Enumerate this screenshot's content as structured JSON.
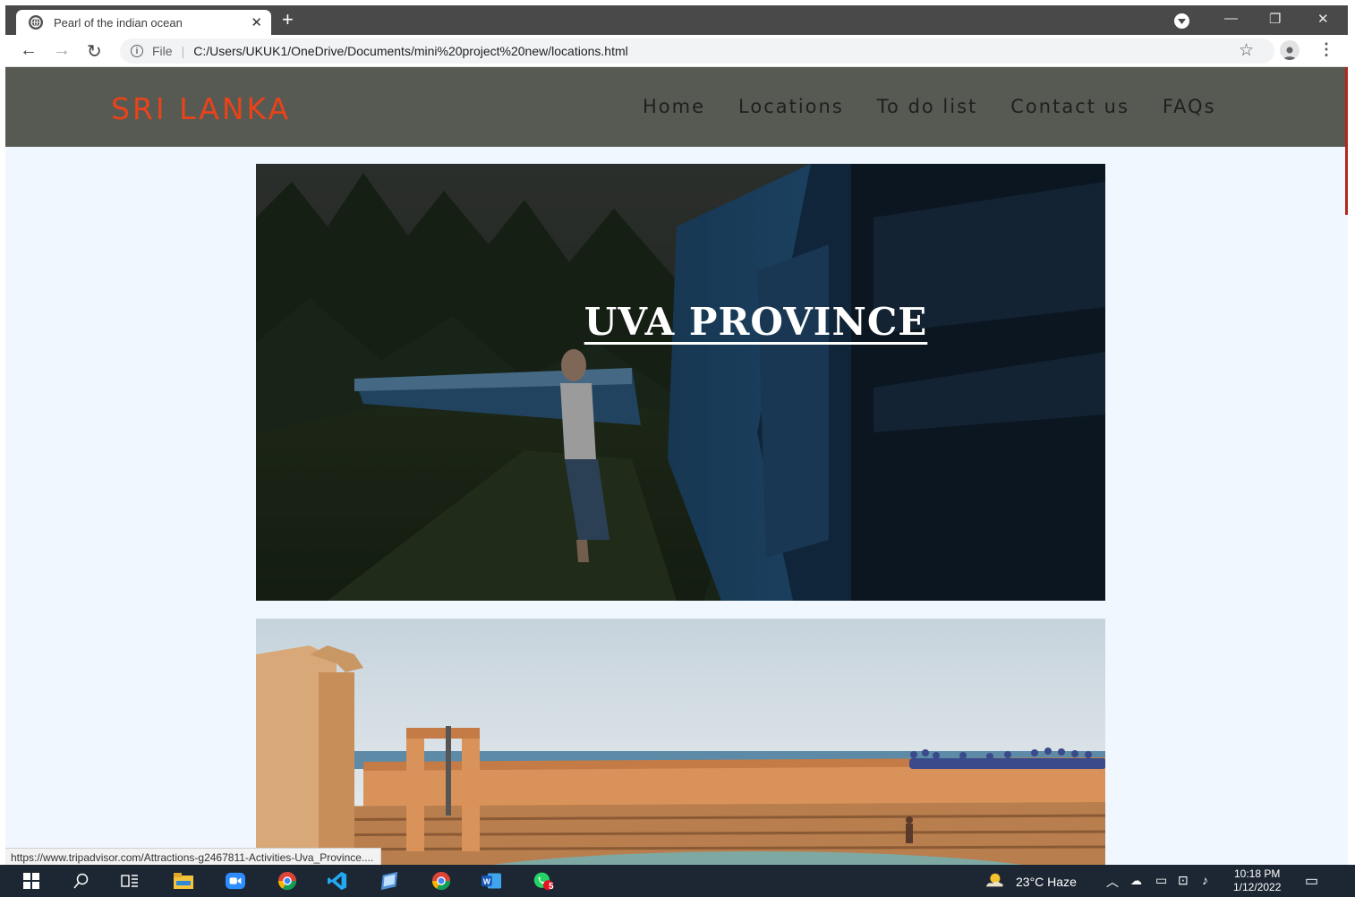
{
  "browser": {
    "tab_title": "Pearl of the indian ocean",
    "tab_close": "✕",
    "new_tab": "+",
    "omnibox_prefix": "File",
    "omnibox_separator": "|",
    "url": "C:/Users/UKUK1/OneDrive/Documents/mini%20project%20new/locations.html",
    "status_url": "https://www.tripadvisor.com/Attractions-g2467811-Activities-Uva_Province...."
  },
  "site": {
    "logo": "SRI LANKA",
    "nav": [
      "Home",
      "Locations",
      "To do list",
      "Contact us",
      "FAQs"
    ],
    "cards": [
      {
        "title": "UVA PROVINCE"
      }
    ],
    "colors": {
      "header_bg": "#575a52",
      "logo": "#e8431a",
      "page_bg": "#f0f7ff"
    }
  },
  "taskbar": {
    "weather": "23°C  Haze",
    "time": "10:18 PM",
    "date": "1/12/2022",
    "whatsapp_badge": "5"
  }
}
